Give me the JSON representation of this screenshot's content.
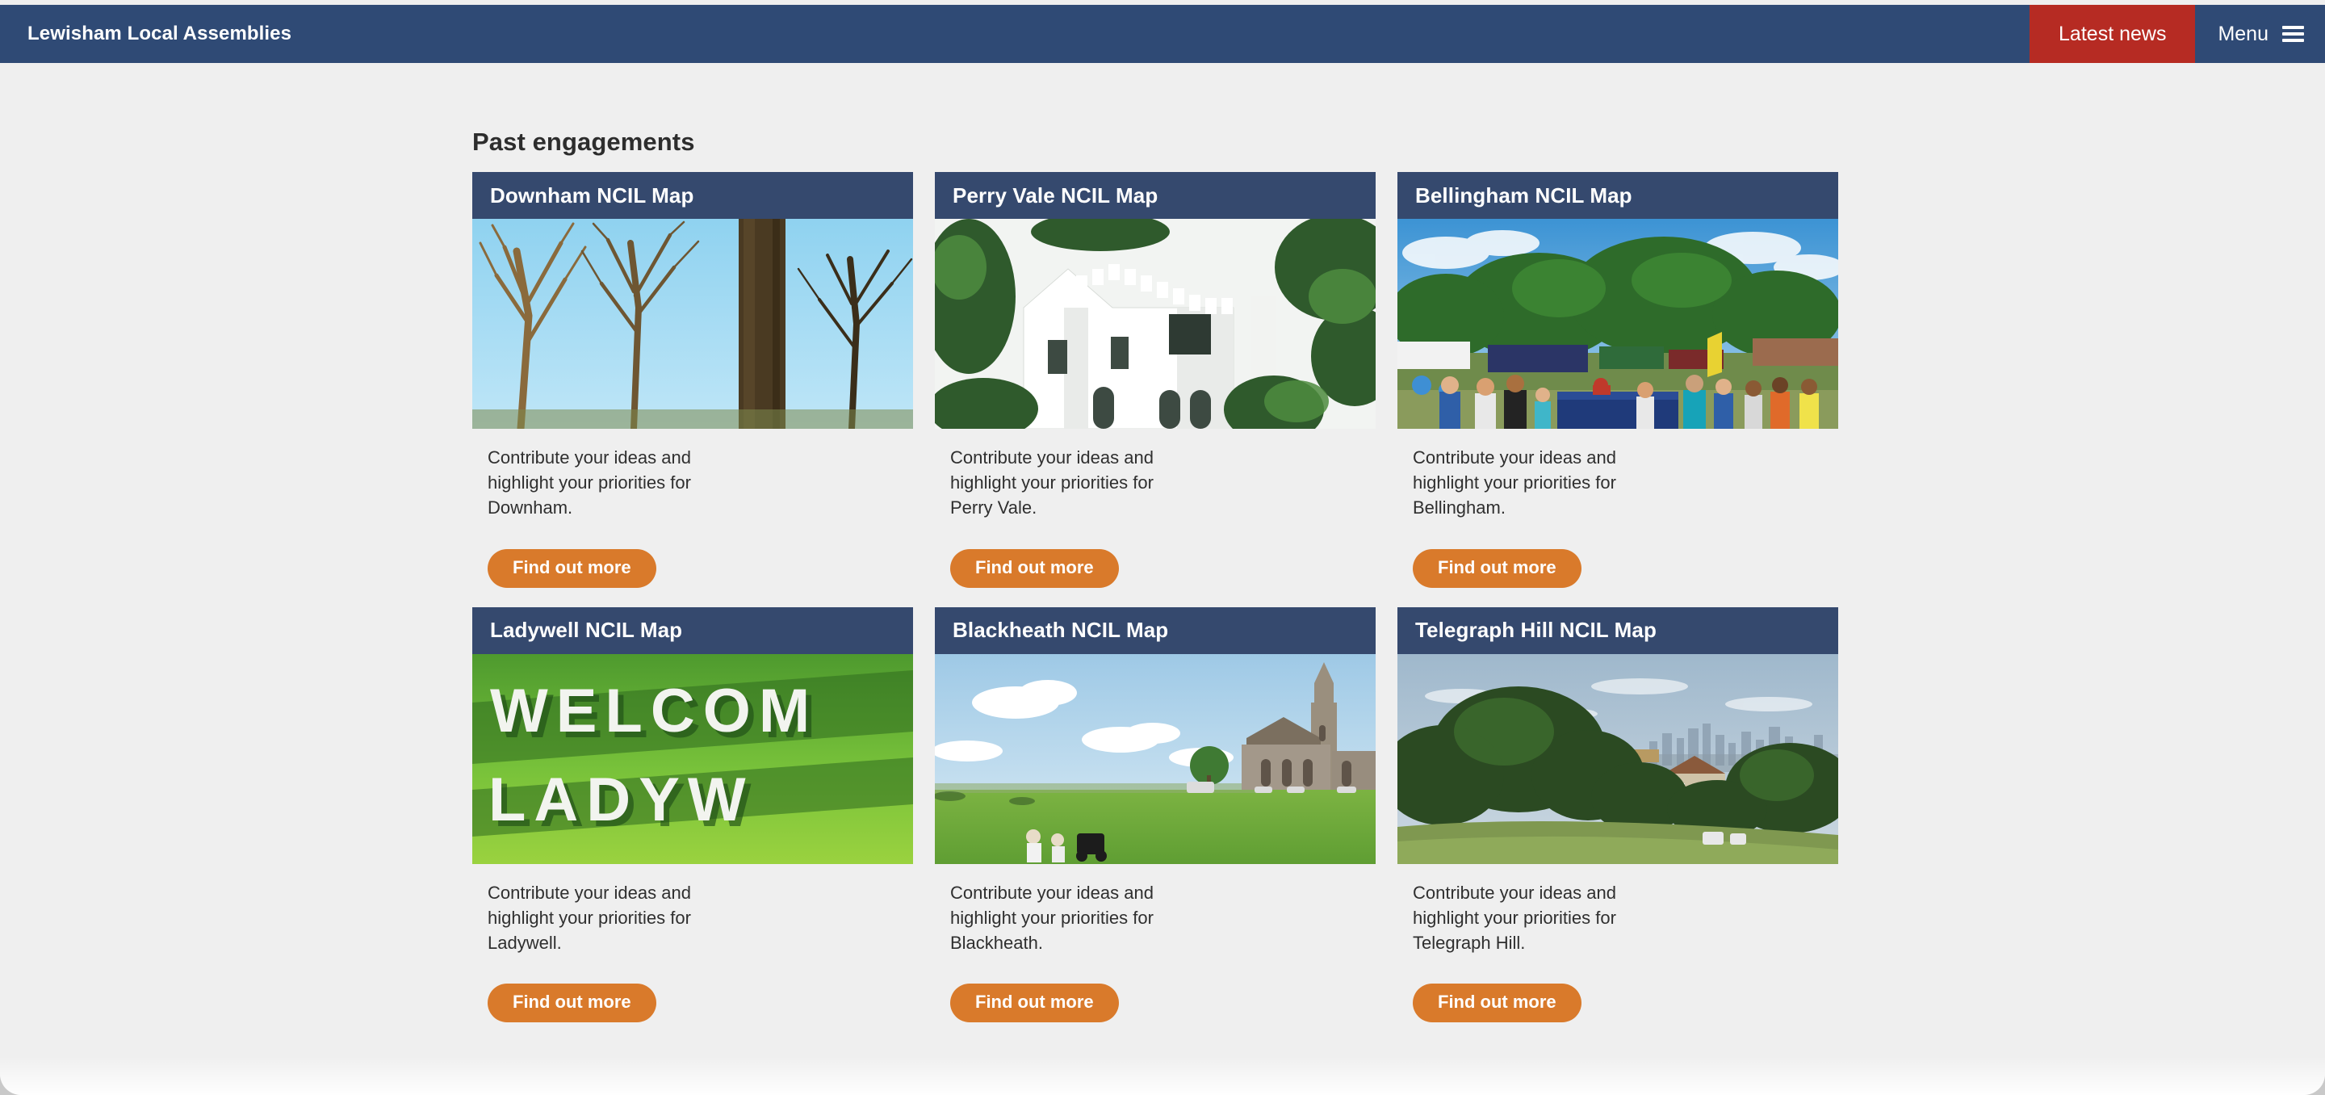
{
  "header": {
    "brand": "Lewisham Local Assemblies",
    "latest_news_label": "Latest news",
    "menu_label": "Menu",
    "menu_icon": "hamburger-icon",
    "bg_color": "#2f4a75",
    "latest_news_color": "#b62b23"
  },
  "main": {
    "page_title": "Past engagements",
    "background_color": "#efefef",
    "card_header_color": "#35496e",
    "button_color": "#d97a2b",
    "cards": [
      {
        "title": "Downham NCIL Map",
        "description": "Contribute your ideas and highlight your priorities for Downham.",
        "button_label": "Find out more",
        "image_alt": "Bare winter tree branches against a blue sky in a park"
      },
      {
        "title": "Perry Vale NCIL Map",
        "description": "Contribute your ideas and highlight your priorities for Perry Vale.",
        "button_label": "Find out more",
        "image_alt": "White gothic-style building framed by green trees"
      },
      {
        "title": "Bellingham NCIL Map",
        "description": "Contribute your ideas and highlight your priorities for Bellingham.",
        "button_label": "Find out more",
        "image_alt": "Crowds at an outdoor community fair with gazebos and trees"
      },
      {
        "title": "Ladywell NCIL Map",
        "description": "Contribute your ideas and highlight your priorities for Ladywell.",
        "button_label": "Find out more",
        "image_alt": "Green mural reading WELCOME TO LADYWELL in large white letters"
      },
      {
        "title": "Blackheath NCIL Map",
        "description": "Contribute your ideas and highlight your priorities for Blackheath.",
        "button_label": "Find out more",
        "image_alt": "Open green heath with a stone church and spire on the right"
      },
      {
        "title": "Telegraph Hill NCIL Map",
        "description": "Contribute your ideas and highlight your priorities for Telegraph Hill.",
        "button_label": "Find out more",
        "image_alt": "View from a grassy hill over trees towards the London skyline"
      }
    ]
  }
}
